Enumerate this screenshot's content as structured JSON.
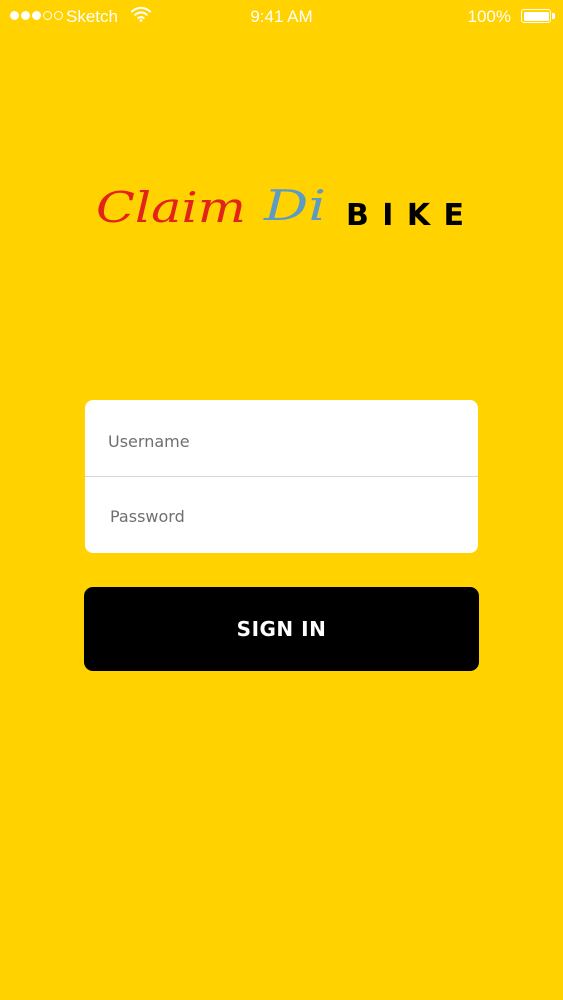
{
  "status_bar": {
    "carrier": "Sketch",
    "time": "9:41 AM",
    "battery": "100%",
    "signal_bars": 3,
    "signal_total": 5,
    "wifi_icon": "wifi-icon",
    "battery_level": 1.0
  },
  "logo": {
    "part1": "Claim",
    "part2": "Di",
    "part3": "BIKE",
    "colors": {
      "claim": "#E2231A",
      "di": "#5E9BC4",
      "bike": "#000000"
    }
  },
  "login": {
    "username_placeholder": "Username",
    "password_placeholder": "Password",
    "signin_label": "SIGN IN"
  },
  "colors": {
    "background": "#FFD200",
    "button": "#000000",
    "card": "#FFFFFF"
  }
}
